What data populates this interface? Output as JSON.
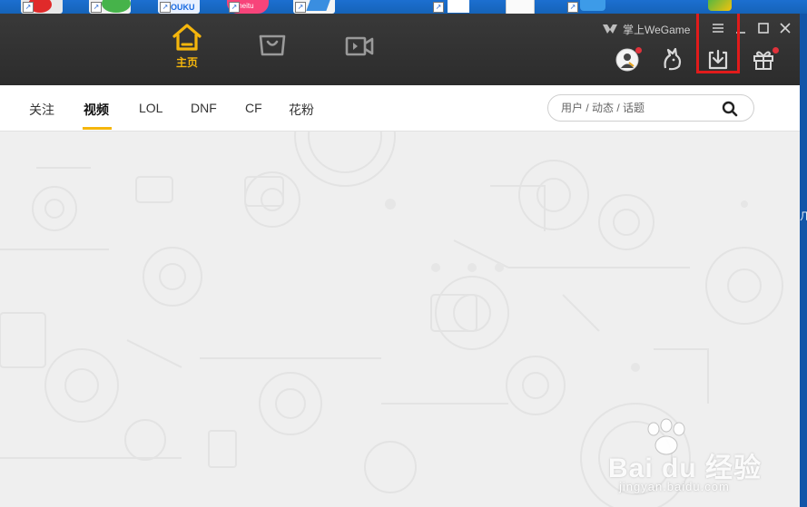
{
  "app": {
    "brand": "掌上WeGame",
    "accent_color": "#f5b60c",
    "titlebar_color": "#333333",
    "highlight_color": "#e11b1b"
  },
  "nav": {
    "tabs": [
      {
        "label": "主页",
        "icon": "home-icon",
        "active": true
      },
      {
        "label": "",
        "icon": "store-icon",
        "active": false
      },
      {
        "label": "",
        "icon": "video-icon",
        "active": false
      }
    ]
  },
  "toolbar": {
    "icons": [
      "avatar-icon",
      "bunny-icon",
      "download-icon",
      "gift-icon"
    ]
  },
  "window_controls": [
    "menu-icon",
    "minimize-icon",
    "maximize-icon",
    "close-icon"
  ],
  "subnav": {
    "items": [
      "关注",
      "视频",
      "LOL",
      "DNF",
      "CF",
      "花粉"
    ],
    "active": "视频"
  },
  "search": {
    "placeholder": "用户 / 动态 / 话题"
  },
  "watermark": {
    "main": "Bai du 经验",
    "sub": "jingyan.baidu.com"
  }
}
